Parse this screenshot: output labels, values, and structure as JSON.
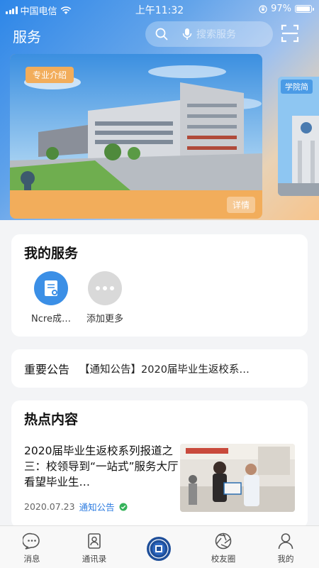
{
  "statusbar": {
    "carrier": "中国电信",
    "time": "上午11:32",
    "battery": "97%"
  },
  "header": {
    "title": "服务",
    "search_placeholder": "搜索服务"
  },
  "banner": {
    "tag": "专业介绍",
    "detail": "详情",
    "next_tag": "学院简"
  },
  "services": {
    "title": "我的服务",
    "items": [
      {
        "label": "Ncre成…",
        "icon": "certificate-icon"
      },
      {
        "label": "添加更多",
        "icon": "more-icon"
      }
    ]
  },
  "notice": {
    "title": "重要公告",
    "text": "【通知公告】2020届毕业生返校系…"
  },
  "hot": {
    "title": "热点内容",
    "news": {
      "title": "2020届毕业生返校系列报道之三：校领导到“一站式”服务大厅看望毕业生…",
      "date": "2020.07.23",
      "category": "通知公告"
    }
  },
  "tabs": [
    {
      "label": "消息",
      "icon": "message-icon"
    },
    {
      "label": "通讯录",
      "icon": "contacts-icon"
    },
    {
      "label": "",
      "icon": "school-logo-icon"
    },
    {
      "label": "校友圈",
      "icon": "aperture-icon"
    },
    {
      "label": "我的",
      "icon": "user-icon"
    }
  ],
  "colors": {
    "accent": "#2d7ce0",
    "banner_orange": "#f2ad5b"
  }
}
